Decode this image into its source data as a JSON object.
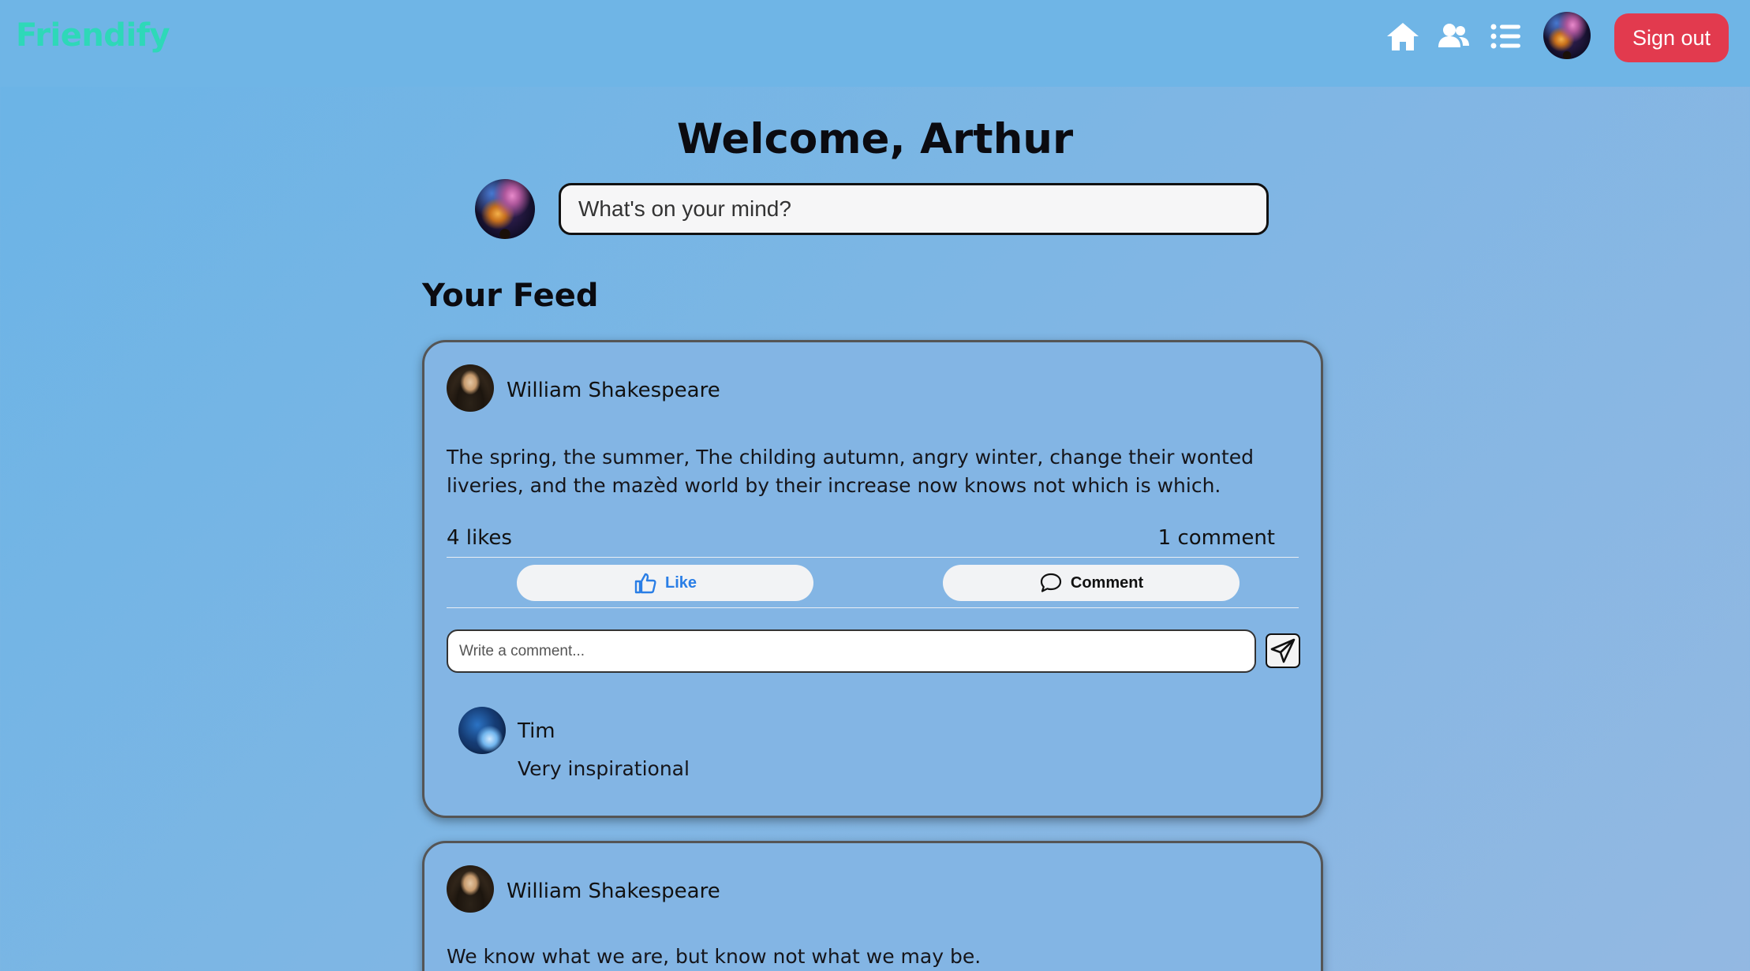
{
  "header": {
    "brand": "Friendify",
    "nav": [
      {
        "name": "home-icon"
      },
      {
        "name": "friends-icon"
      },
      {
        "name": "list-icon"
      }
    ],
    "signout_label": "Sign out"
  },
  "welcome": {
    "title": "Welcome, Arthur"
  },
  "composer": {
    "placeholder": "What's on your mind?"
  },
  "feed": {
    "title": "Your Feed",
    "posts": [
      {
        "author": "William Shakespeare",
        "text": "The spring, the summer, The childing autumn, angry winter, change their wonted liveries, and the mazèd world by their increase now knows not which is which.",
        "likes": "4 likes",
        "comments_count": "1 comment",
        "like_label": "Like",
        "comment_label": "Comment",
        "comment_placeholder": "Write a comment...",
        "comments": [
          {
            "author": "Tim",
            "text": "Very inspirational"
          }
        ]
      },
      {
        "author": "William Shakespeare",
        "text": "We know what we are, but know not what we may be."
      }
    ]
  },
  "colors": {
    "brand": "#2ed8b8",
    "signout": "#e23a4e",
    "like_accent": "#2a7ee6"
  }
}
